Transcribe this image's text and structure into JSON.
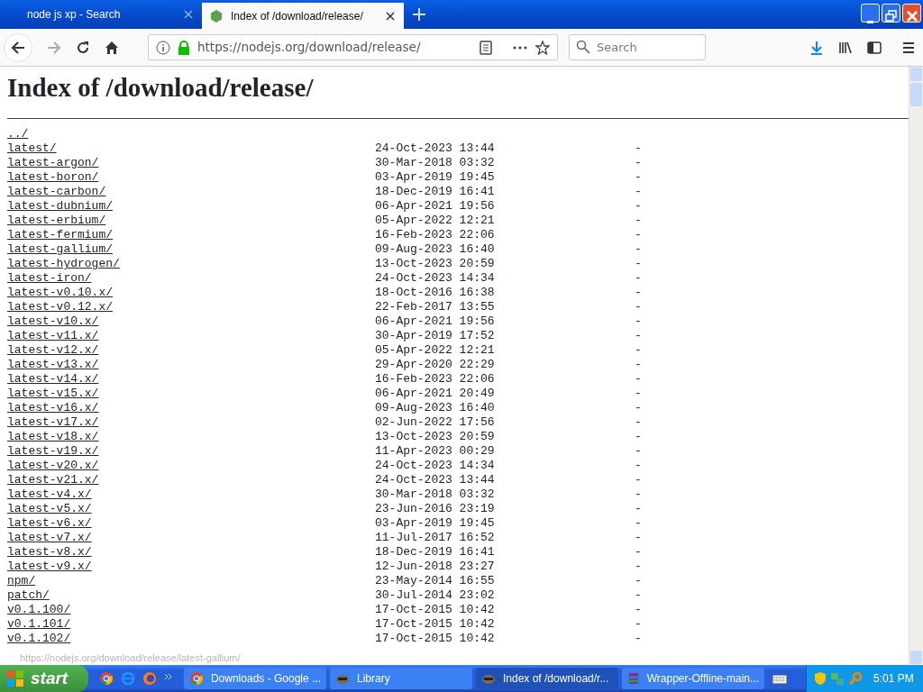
{
  "tabs": [
    {
      "label": "node js xp - Search",
      "selected": false
    },
    {
      "label": "Index of /download/release/",
      "selected": true
    }
  ],
  "toolbar": {
    "url": "https://nodejs.org/download/release/",
    "search_placeholder": "Search"
  },
  "page": {
    "title": "Index of /download/release/",
    "entries": [
      {
        "name": "../"
      },
      {
        "name": "latest/",
        "date": "24-Oct-2023 13:44",
        "size": "-"
      },
      {
        "name": "latest-argon/",
        "date": "30-Mar-2018 03:32",
        "size": "-"
      },
      {
        "name": "latest-boron/",
        "date": "03-Apr-2019 19:45",
        "size": "-"
      },
      {
        "name": "latest-carbon/",
        "date": "18-Dec-2019 16:41",
        "size": "-"
      },
      {
        "name": "latest-dubnium/",
        "date": "06-Apr-2021 19:56",
        "size": "-"
      },
      {
        "name": "latest-erbium/",
        "date": "05-Apr-2022 12:21",
        "size": "-"
      },
      {
        "name": "latest-fermium/",
        "date": "16-Feb-2023 22:06",
        "size": "-"
      },
      {
        "name": "latest-gallium/",
        "date": "09-Aug-2023 16:40",
        "size": "-"
      },
      {
        "name": "latest-hydrogen/",
        "date": "13-Oct-2023 20:59",
        "size": "-"
      },
      {
        "name": "latest-iron/",
        "date": "24-Oct-2023 14:34",
        "size": "-"
      },
      {
        "name": "latest-v0.10.x/",
        "date": "18-Oct-2016 16:38",
        "size": "-"
      },
      {
        "name": "latest-v0.12.x/",
        "date": "22-Feb-2017 13:55",
        "size": "-"
      },
      {
        "name": "latest-v10.x/",
        "date": "06-Apr-2021 19:56",
        "size": "-"
      },
      {
        "name": "latest-v11.x/",
        "date": "30-Apr-2019 17:52",
        "size": "-"
      },
      {
        "name": "latest-v12.x/",
        "date": "05-Apr-2022 12:21",
        "size": "-"
      },
      {
        "name": "latest-v13.x/",
        "date": "29-Apr-2020 22:29",
        "size": "-"
      },
      {
        "name": "latest-v14.x/",
        "date": "16-Feb-2023 22:06",
        "size": "-"
      },
      {
        "name": "latest-v15.x/",
        "date": "06-Apr-2021 20:49",
        "size": "-"
      },
      {
        "name": "latest-v16.x/",
        "date": "09-Aug-2023 16:40",
        "size": "-"
      },
      {
        "name": "latest-v17.x/",
        "date": "02-Jun-2022 17:56",
        "size": "-"
      },
      {
        "name": "latest-v18.x/",
        "date": "13-Oct-2023 20:59",
        "size": "-"
      },
      {
        "name": "latest-v19.x/",
        "date": "11-Apr-2023 00:29",
        "size": "-"
      },
      {
        "name": "latest-v20.x/",
        "date": "24-Oct-2023 14:34",
        "size": "-"
      },
      {
        "name": "latest-v21.x/",
        "date": "24-Oct-2023 13:44",
        "size": "-"
      },
      {
        "name": "latest-v4.x/",
        "date": "30-Mar-2018 03:32",
        "size": "-"
      },
      {
        "name": "latest-v5.x/",
        "date": "23-Jun-2016 23:19",
        "size": "-"
      },
      {
        "name": "latest-v6.x/",
        "date": "03-Apr-2019 19:45",
        "size": "-"
      },
      {
        "name": "latest-v7.x/",
        "date": "11-Jul-2017 16:52",
        "size": "-"
      },
      {
        "name": "latest-v8.x/",
        "date": "18-Dec-2019 16:41",
        "size": "-"
      },
      {
        "name": "latest-v9.x/",
        "date": "12-Jun-2018 23:27",
        "size": "-"
      },
      {
        "name": "npm/",
        "date": "23-May-2014 16:55",
        "size": "-"
      },
      {
        "name": "patch/",
        "date": "30-Jul-2014 23:02",
        "size": "-"
      },
      {
        "name": "v0.1.100/",
        "date": "17-Oct-2015 10:42",
        "size": "-"
      },
      {
        "name": "v0.1.101/",
        "date": "17-Oct-2015 10:42",
        "size": "-"
      },
      {
        "name": "v0.1.102/",
        "date": "17-Oct-2015 10:42",
        "size": "-"
      }
    ],
    "status_link": "https://nodejs.org/download/release/latest-gallium/"
  },
  "taskbar": {
    "start": "start",
    "tasks": [
      {
        "label": "Downloads - Google ...",
        "selected": false
      },
      {
        "label": "Library",
        "selected": false
      },
      {
        "label": "Index of /download/r...",
        "selected": true
      },
      {
        "label": "Wrapper-Offline-main...",
        "selected": false
      }
    ],
    "clock": "5:01 PM"
  }
}
